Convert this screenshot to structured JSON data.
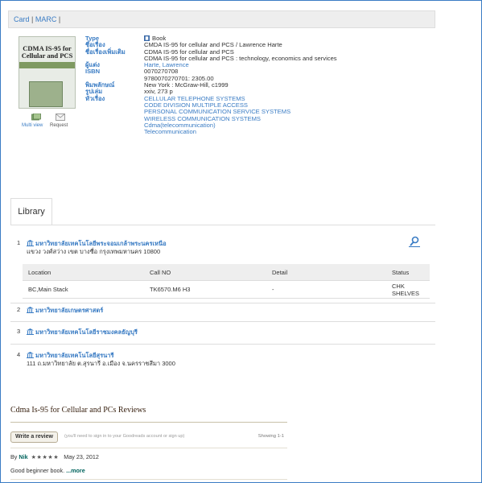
{
  "tabs": {
    "card": "Card",
    "sep": "|",
    "marc": "MARC",
    "trail": "|"
  },
  "cover": {
    "title": "CDMA IS-95 for Cellular and PCS"
  },
  "actions": {
    "multiview": "Multi view",
    "request": "Request"
  },
  "record": [
    {
      "label": "Type",
      "value": "Book",
      "link": false,
      "icon": "book-icon"
    },
    {
      "label": "ชื่อเรื่อง",
      "value": "CMDA IS-95 for cellular and PCS / Lawrence Harte",
      "link": false
    },
    {
      "label": "ชื่อเรื่องเพิ่มเติม",
      "value": "CDMA IS-95 for cellular and PCS",
      "link": false
    },
    {
      "label": "",
      "value": "CDMA IS-95 for cellular and PCS : technology, economics and services",
      "link": false
    },
    {
      "label": "ผู้แต่ง",
      "value": "Harte, Lawrence",
      "link": true
    },
    {
      "label": "ISBN",
      "value": "0070270708",
      "link": false
    },
    {
      "label": "",
      "value": "9780070270701: 2305.00",
      "link": false
    },
    {
      "label": "พิมพลักษณ์",
      "value": "New York : McGraw-Hill, c1999",
      "link": false
    },
    {
      "label": "รูปเล่ม",
      "value": "xxiv, 273 p",
      "link": false
    },
    {
      "label": "หัวเรื่อง",
      "value": "CELLULAR TELEPHONE SYSTEMS",
      "link": true
    },
    {
      "label": "",
      "value": "CODE DIVISION MULTIPLE ACCESS",
      "link": true
    },
    {
      "label": "",
      "value": "PERSONAL COMMUNICATION SERVICE SYSTEMS",
      "link": true
    },
    {
      "label": "",
      "value": "WIRELESS COMMUNICATION SYSTEMS",
      "link": true
    },
    {
      "label": "",
      "value": "Cdma(telecommunication)",
      "link": true
    },
    {
      "label": "",
      "value": "Telecommunication",
      "link": true
    }
  ],
  "library_tab": "Library",
  "libraries": [
    {
      "num": "1",
      "name": "มหาวิทยาลัยเทคโนโลยีพระจอมเกล้าพระนครเหนือ",
      "address": "แขวง วงศ์สว่าง เขต บางซื่อ กรุงเทพมหานคร 10800"
    },
    {
      "num": "2",
      "name": "มหาวิทยาลัยเกษตรศาสตร์",
      "address": ""
    },
    {
      "num": "3",
      "name": "มหาวิทยาลัยเทคโนโลยีราชมงคลธัญบุรี",
      "address": ""
    },
    {
      "num": "4",
      "name": "มหาวิทยาลัยเทคโนโลยีสุรนารี",
      "address": "111 ถ.มหาวิทยาลัย ต.สุรนารี อ.เมือง จ.นครราชสีมา 3000"
    }
  ],
  "holdings": {
    "headers": [
      "Location",
      "Call NO",
      "Detail",
      "Status"
    ],
    "rows": [
      [
        "BC,Main Stack",
        "TK6570.M6 H3",
        "-",
        "CHK SHELVES"
      ]
    ]
  },
  "reviews": {
    "title": "Cdma Is-95 for Cellular and PCs Reviews",
    "write_button": "Write a review",
    "note": "(you'll need to sign in to your Goodreads account or sign up)",
    "showing": "Showing 1-1",
    "by": "By",
    "reviewer": "Nik",
    "stars": "★★★★★",
    "date": "May 23, 2012",
    "text": "Good beginner book.",
    "more": "...more"
  },
  "colors": {
    "link": "#3a7cc4",
    "goodreads_green": "#00635d",
    "frame": "#3a7cc4"
  }
}
